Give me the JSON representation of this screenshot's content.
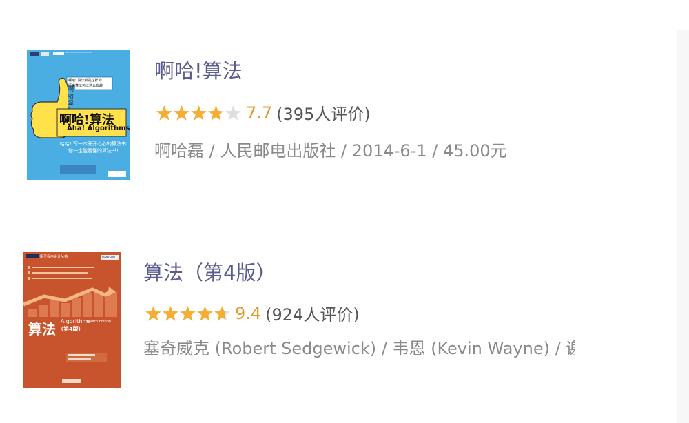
{
  "books": [
    {
      "title": "啊哈!算法",
      "rating_value": 7.7,
      "score": "7.7",
      "count": "(395人评价)",
      "meta": "啊哈磊 / 人民邮电出版社 / 2014-6-1 / 45.00元",
      "cover": {
        "title_cn": "啊哈!算法",
        "title_en": "Aha! Algorithms",
        "author_vertical": "啊哈磊",
        "tagline_1": "哈哈! 写一本开开心心的算法书",
        "tagline_2": "你一定能看懂的算法书!",
        "badge_1": "啊哈! 算法就是这样的",
        "badge_2": "原来算法可以这么有趣"
      }
    },
    {
      "title": "算法（第4版）",
      "rating_value": 9.4,
      "score": "9.4",
      "count": "(924人评价)",
      "meta": "塞奇威克 (Robert Sedgewick) / 韦恩 (Kevin Wayne) / 谢",
      "cover": {
        "title_cn": "算法",
        "title_en": "Algorithms",
        "edition_en": "Fourth Edition",
        "edition_cn": "（第4版）",
        "series": "图灵程序设计丛书",
        "publisher_logo": "PEARSON"
      }
    }
  ],
  "colors": {
    "title": "#5b5d8f",
    "star_fill": "#f5ad32",
    "star_empty": "#dedede",
    "score": "#e19b34",
    "meta": "#8a8a8a",
    "cover1_bg": "#4aaee3",
    "cover2_bg": "#c8542d"
  }
}
